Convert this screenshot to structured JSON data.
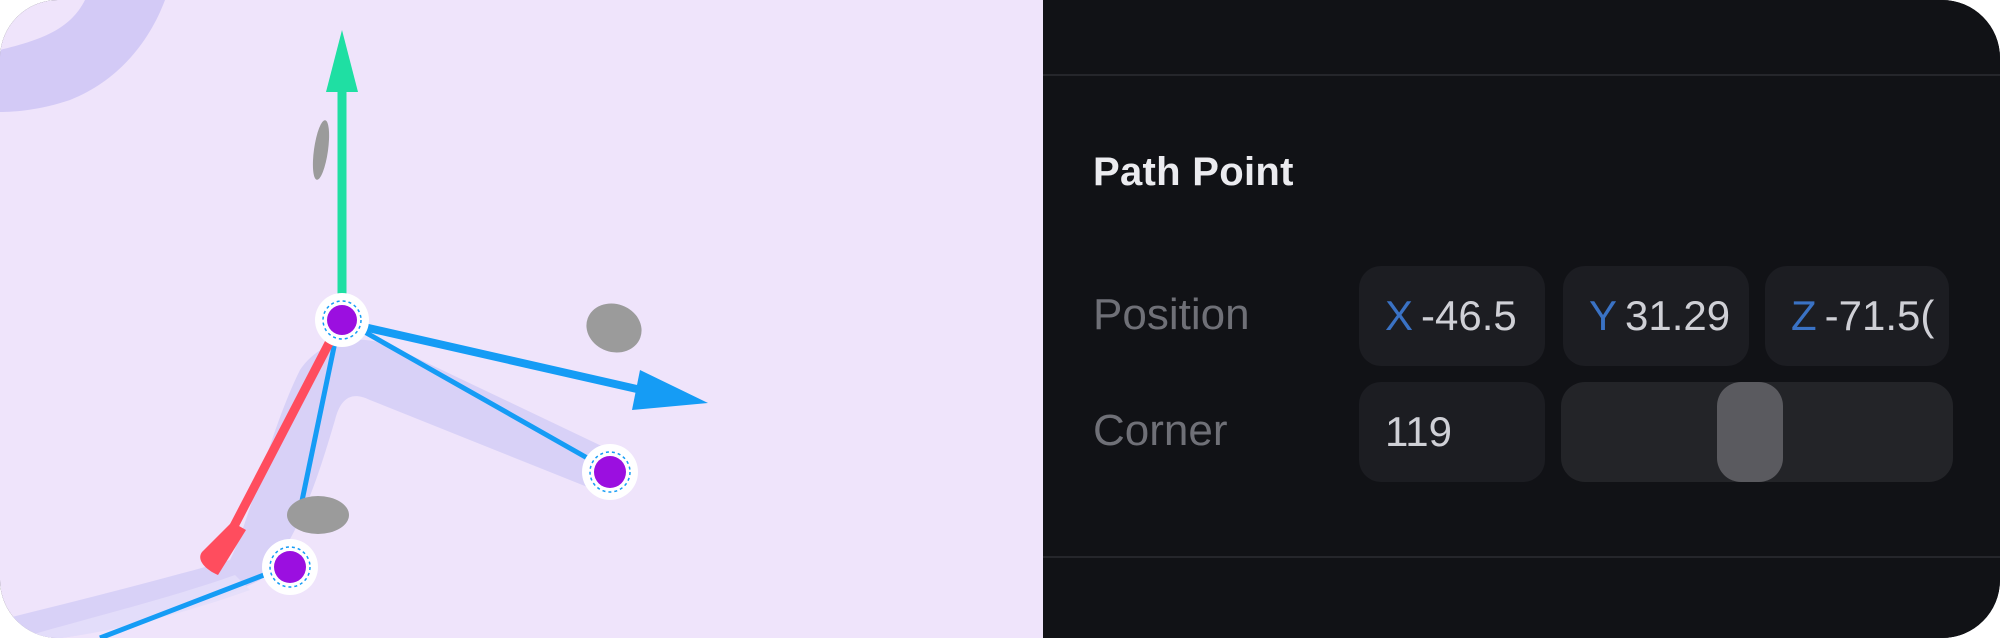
{
  "viewport": {
    "background": "#efe4fb",
    "gizmo": {
      "y_axis_color": "#1fdfa3",
      "x_axis_color": "#ff4d5e",
      "z_axis_color": "#159cf5",
      "point_color": "#9b0fe0"
    }
  },
  "panel": {
    "section_title": "Path Point",
    "position": {
      "label": "Position",
      "x": {
        "axis": "X",
        "value": "-46.5"
      },
      "y": {
        "axis": "Y",
        "value": "31.29"
      },
      "z": {
        "axis": "Z",
        "value": "-71.5("
      }
    },
    "corner": {
      "label": "Corner",
      "value": "119",
      "slider_fraction": 0.48
    },
    "axis_label_color": "#3a72c4"
  }
}
